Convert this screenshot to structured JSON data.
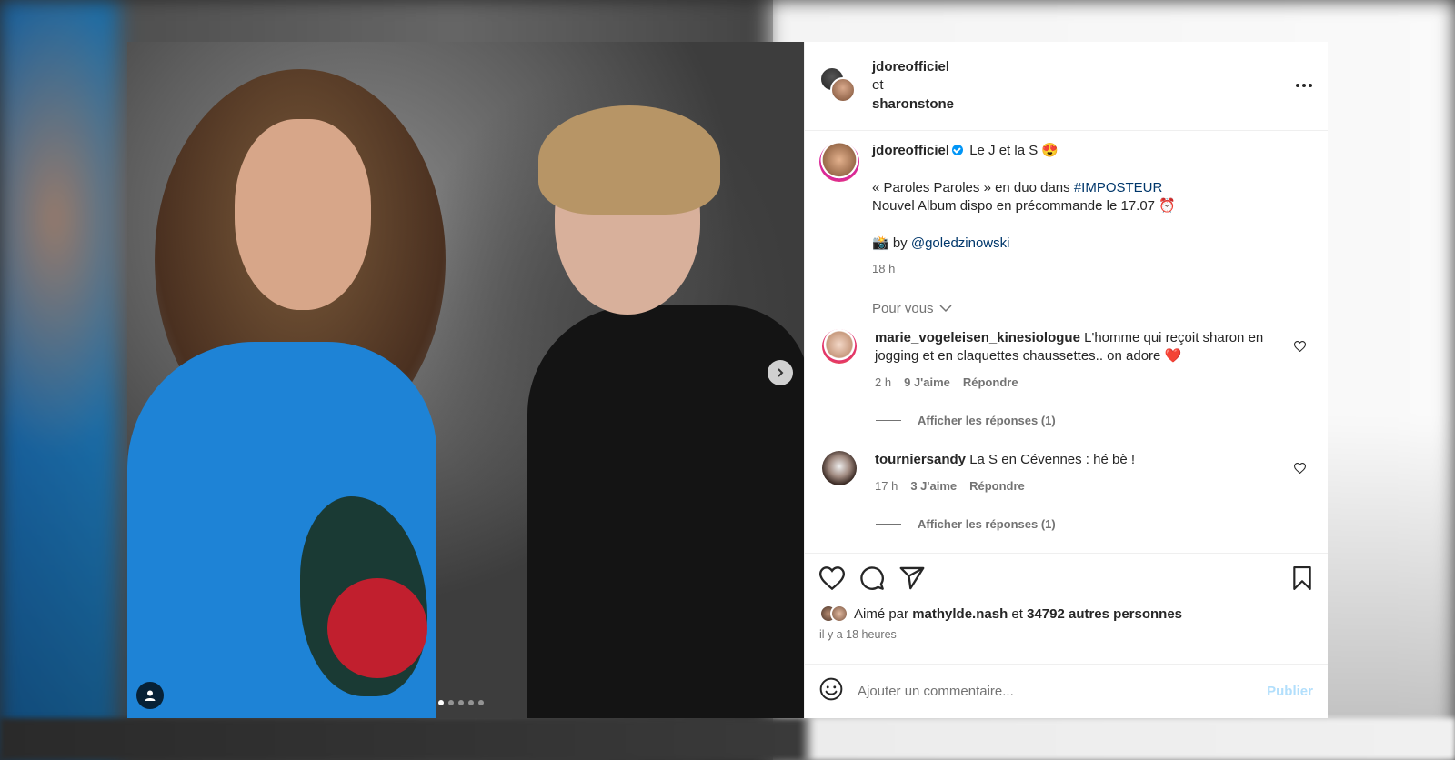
{
  "header": {
    "user1": "jdoreofficiel",
    "connector": "et",
    "user2": "sharonstone"
  },
  "caption": {
    "username": "jdoreofficiel",
    "title": "Le J et la S 😍",
    "line1_prefix": "« Paroles Paroles » en duo dans ",
    "hashtag": "#IMPOSTEUR",
    "line2": "Nouvel Album dispo en précommande le 17.07 ⏰",
    "credit_prefix": "📸 by ",
    "mention": "@goledzinowski",
    "time": "18 h"
  },
  "pour_vous": "Pour vous",
  "comments": [
    {
      "username": "marie_vogeleisen_kinesiologue",
      "text": "L'homme qui reçoit sharon en jogging et en claquettes chaussettes.. on adore ❤️",
      "time": "2 h",
      "likes": "9 J'aime",
      "reply": "Répondre",
      "show_replies": "Afficher les réponses (1)"
    },
    {
      "username": "tourniersandy",
      "text": "La S en Cévennes : hé bè !",
      "time": "17 h",
      "likes": "3 J'aime",
      "reply": "Répondre",
      "show_replies": "Afficher les réponses (1)"
    }
  ],
  "likes": {
    "prefix": "Aimé par ",
    "user": "mathylde.nash",
    "middle": " et ",
    "count": "34792 autres personnes"
  },
  "posted_ago": "il y a 18 heures",
  "add_comment": {
    "placeholder": "Ajouter un commentaire...",
    "publish": "Publier"
  },
  "carousel": {
    "total": 5,
    "active": 1
  },
  "colors": {
    "link": "#00376b",
    "verified": "#0095f6",
    "publish_disabled": "#b2dffc",
    "heart": "#ed4956"
  }
}
